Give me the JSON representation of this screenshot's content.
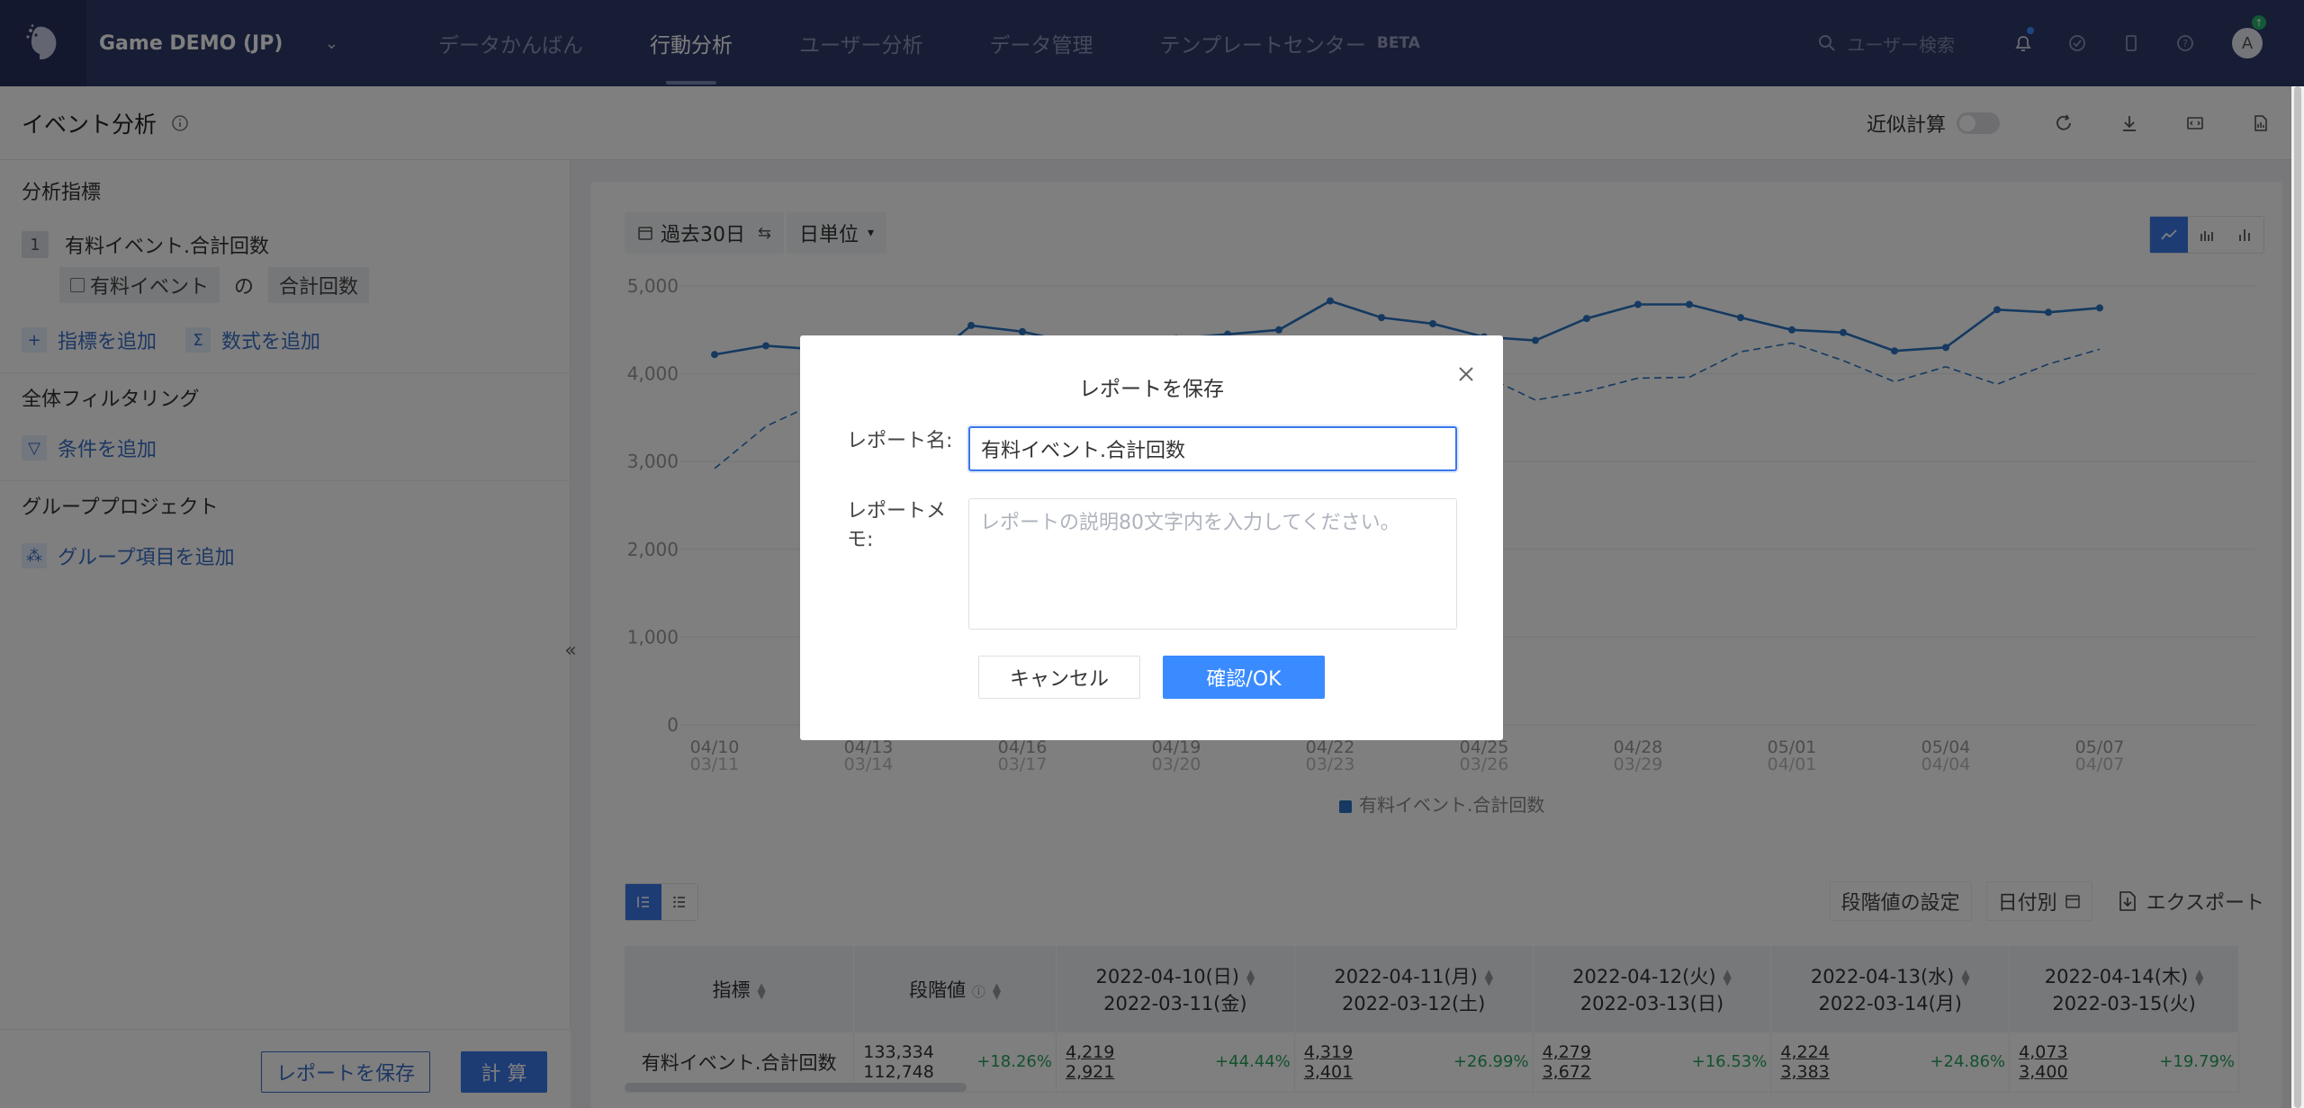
{
  "topnav": {
    "project": "Game DEMO (JP)",
    "tabs": [
      "データかんばん",
      "行動分析",
      "ユーザー分析",
      "データ管理",
      "テンプレートセンター"
    ],
    "active_tab": "行動分析",
    "beta": "BETA",
    "search_placeholder": "ユーザー検索",
    "avatar": "A"
  },
  "header": {
    "title": "イベント分析",
    "approx_label": "近似計算"
  },
  "left": {
    "metrics_title": "分析指標",
    "metric_index": "1",
    "metric_name": "有料イベント.合計回数",
    "event_chip": "有料イベント",
    "of_label": "の",
    "agg_chip": "合計回数",
    "add_metric": "指標を追加",
    "add_formula": "数式を追加",
    "filter_title": "全体フィルタリング",
    "add_condition": "条件を追加",
    "group_title": "グループプロジェクト",
    "add_group": "グループ項目を追加",
    "collapse": "«",
    "save_report": "レポートを保存",
    "calculate": "計 算"
  },
  "controls": {
    "date_range": "過去30日",
    "unit": "日単位",
    "threshold_setting": "段階値の設定",
    "by_date": "日付別",
    "export": "エクスポート"
  },
  "chart_data": {
    "type": "line",
    "y_ticks": [
      "5,000",
      "4,000",
      "3,000",
      "2,000",
      "1,000",
      "0"
    ],
    "ylim": [
      0,
      5000
    ],
    "x_labels_primary": [
      "04/10",
      "04/13",
      "04/16",
      "04/19",
      "04/22",
      "04/25",
      "04/28",
      "05/01",
      "05/04",
      "05/07"
    ],
    "x_labels_compare": [
      "03/11",
      "03/14",
      "03/17",
      "03/20",
      "03/23",
      "03/26",
      "03/29",
      "04/01",
      "04/04",
      "04/07"
    ],
    "legend": "有料イベント.合計回数",
    "series": [
      {
        "name": "有料イベント.合計回数",
        "style": "solid",
        "color": "#2a73c0",
        "values": [
          4219,
          4319,
          4279,
          4224,
          4073,
          4550,
          4480,
          4350,
          4300,
          4400,
          4450,
          4500,
          4830,
          4640,
          4570,
          4420,
          4380,
          4630,
          4790,
          4790,
          4640,
          4500,
          4470,
          4260,
          4300,
          4730,
          4700,
          4750
        ]
      },
      {
        "name": "有料イベント.合計回数 (比較)",
        "style": "dashed",
        "color": "#2a73c0",
        "values": [
          2921,
          3401,
          3672,
          3383,
          3400,
          3600,
          3700,
          3800,
          3850,
          3900,
          3950,
          4000,
          4050,
          3950,
          4100,
          3980,
          3700,
          3800,
          3950,
          3960,
          4250,
          4350,
          4150,
          3910,
          4080,
          3880,
          4110,
          4280
        ]
      }
    ]
  },
  "modal": {
    "title": "レポートを保存",
    "name_label": "レポート名:",
    "name_value": "有料イベント.合計回数",
    "memo_label": "レポートメモ:",
    "memo_placeholder": "レポートの説明80文字内を入力してください。",
    "cancel": "キャンセル",
    "ok": "確認/OK"
  },
  "table": {
    "headers": [
      "指標",
      "段階値"
    ],
    "date_cols": [
      {
        "d1": "2022-04-10(日)",
        "d2": "2022-03-11(金)",
        "v1": "4,219",
        "v2": "2,921",
        "pct": "+44.44%"
      },
      {
        "d1": "2022-04-11(月)",
        "d2": "2022-03-12(土)",
        "v1": "4,319",
        "v2": "3,401",
        "pct": "+26.99%"
      },
      {
        "d1": "2022-04-12(火)",
        "d2": "2022-03-13(日)",
        "v1": "4,279",
        "v2": "3,672",
        "pct": "+16.53%"
      },
      {
        "d1": "2022-04-13(水)",
        "d2": "2022-03-14(月)",
        "v1": "4,224",
        "v2": "3,383",
        "pct": "+24.86%"
      },
      {
        "d1": "2022-04-14(木)",
        "d2": "2022-03-15(火)",
        "v1": "4,073",
        "v2": "3,400",
        "pct": "+19.79%"
      }
    ],
    "row_name": "有料イベント.合計回数",
    "total_v1": "133,334",
    "total_v2": "112,748",
    "total_pct": "+18.26%"
  }
}
